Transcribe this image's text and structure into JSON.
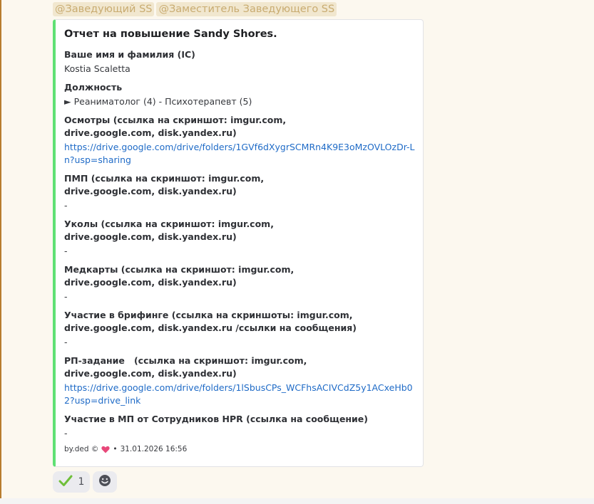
{
  "mentions": [
    "@Заведующий SS",
    "@Заместитель Заведующего SS"
  ],
  "embed": {
    "title": "Отчет на повышение Sandy Shores.",
    "fields": [
      {
        "name": "Ваше имя и фамилия (IC)",
        "value": "Kostia Scaletta"
      },
      {
        "name": "Должность",
        "value": "► Реаниматолог (4) - Психотерапевт (5)"
      },
      {
        "name": "Осмотры (ссылка на скриншот: imgur.com,\ndrive.google.com, disk.yandex.ru)",
        "value": "https://drive.google.com/drive/folders/1GVf6dXygrSCMRn4K9E3oMzOVLOzDr-Ln?usp=sharing"
      },
      {
        "name": "ПМП (ссылка на скриншот: imgur.com,\ndrive.google.com, disk.yandex.ru)",
        "value": "-"
      },
      {
        "name": "Уколы (ссылка на скриншот: imgur.com,\ndrive.google.com, disk.yandex.ru)",
        "value": "-"
      },
      {
        "name": "Медкарты (ссылка на скриншот: imgur.com,\ndrive.google.com, disk.yandex.ru)",
        "value": "-"
      },
      {
        "name": "Участие в брифинге (ссылка на скриншоты: imgur.com,\ndrive.google.com, disk.yandex.ru /ссылки на сообщения)",
        "value": "-"
      },
      {
        "name": "РП-задание   (ссылка на скриншот: imgur.com,\ndrive.google.com, disk.yandex.ru)",
        "value": "https://drive.google.com/drive/folders/1lSbusCPs_WCFhsACIVCdZ5y1ACxeHb02?usp=drive_link"
      },
      {
        "name": "Участие в МП от Сотрудников HPR (ссылка на сообщение)",
        "value": "-"
      }
    ],
    "footer": {
      "author": "by.ded ©",
      "separator": "•",
      "timestamp": "31.01.2026 16:56"
    }
  },
  "reactions": [
    {
      "icon": "check-mark-icon",
      "count": "1"
    },
    {
      "icon": "add-reaction-icon"
    }
  ],
  "colors": {
    "accent_bar": "#5fe074",
    "link": "#1f6bc7",
    "mention_bg": "#f1e7cf",
    "mention_text": "#c9ac71",
    "message_highlight": "#fcf8ef"
  }
}
